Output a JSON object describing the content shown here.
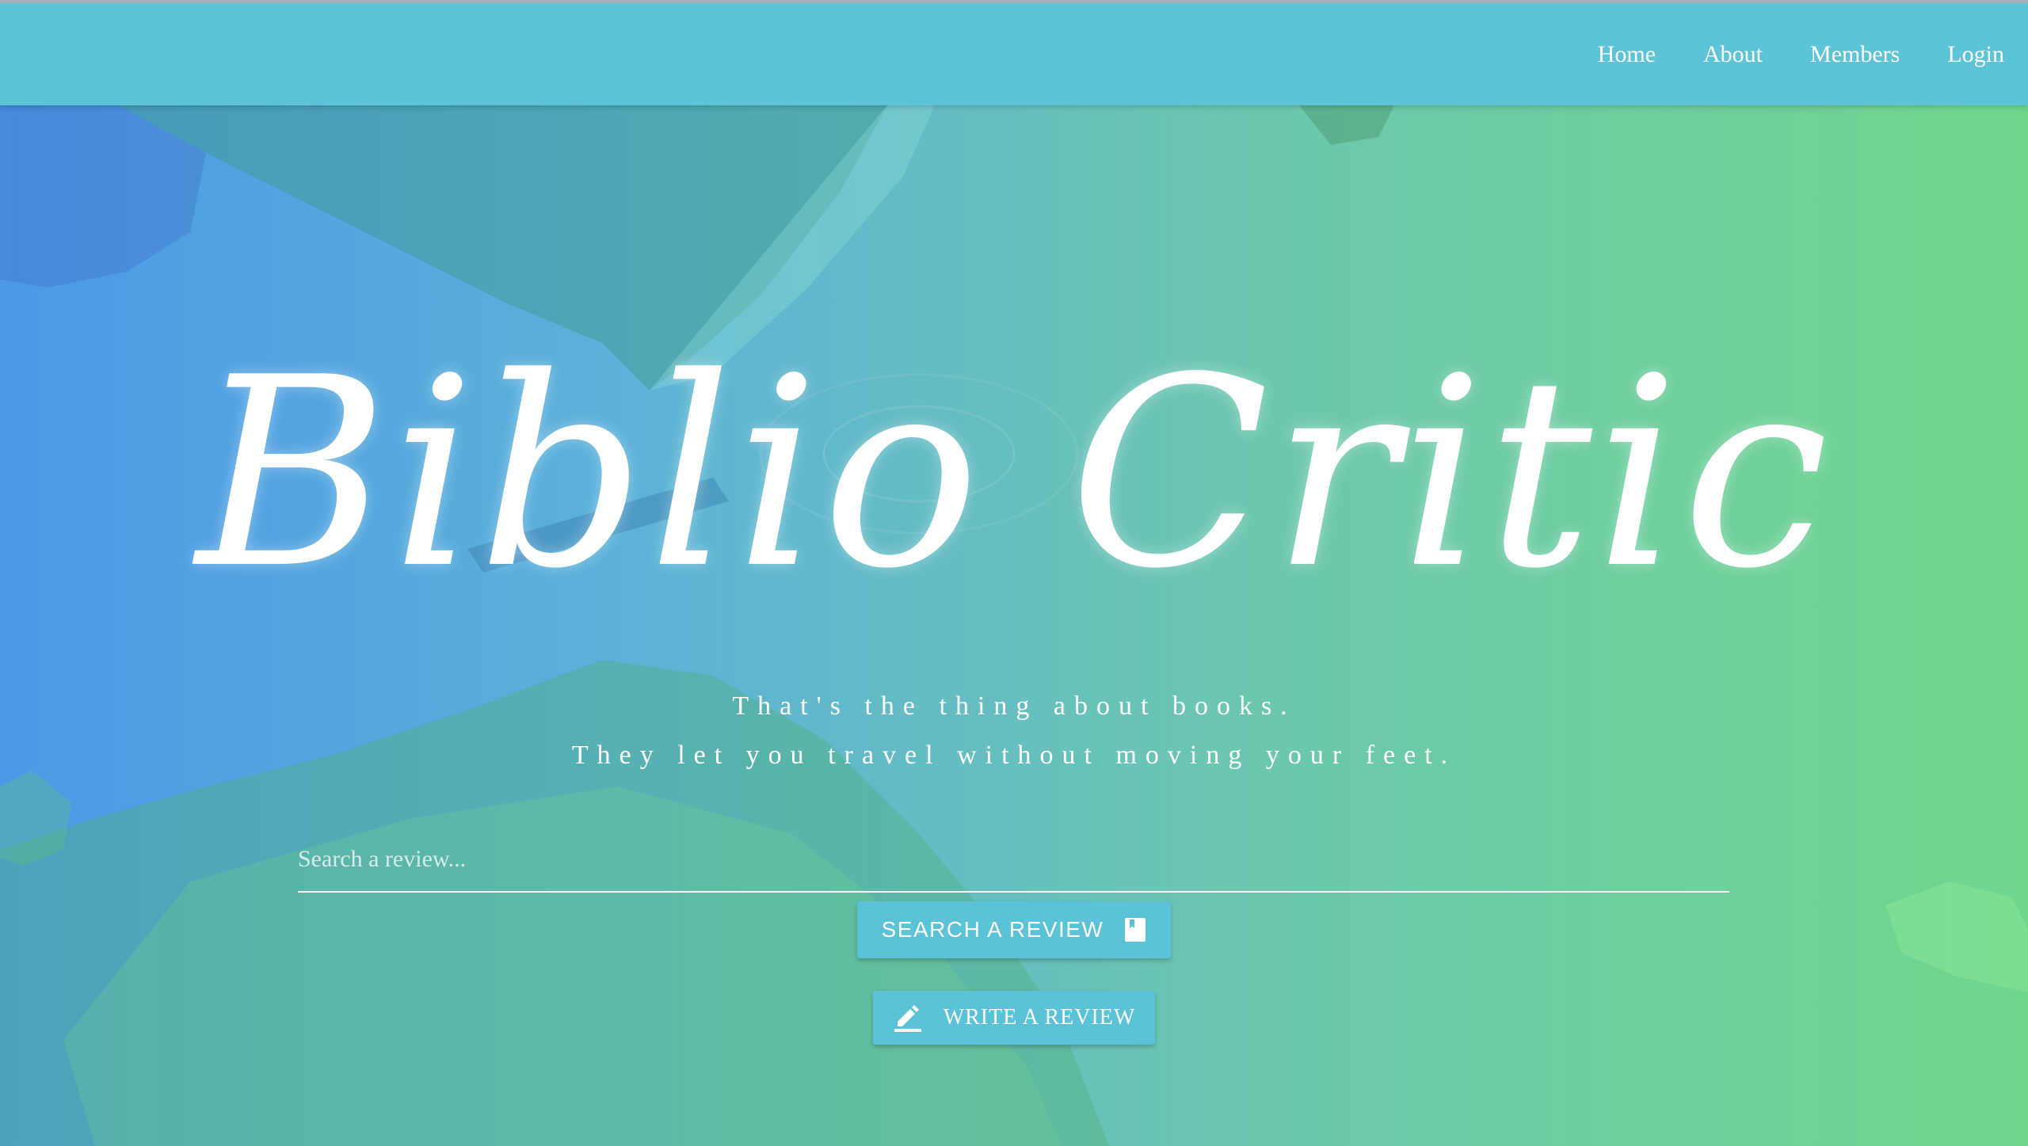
{
  "nav": {
    "links": [
      "Home",
      "About",
      "Members",
      "Login"
    ]
  },
  "hero": {
    "title": "Biblio Critic",
    "tagline_line1": "That's the thing about books.",
    "tagline_line2": "They let you travel without moving your feet."
  },
  "search": {
    "placeholder": "Search a review...",
    "value": ""
  },
  "buttons": {
    "search_label": "SEARCH A REVIEW",
    "search_icon": "book-icon",
    "write_label": "WRITE A REVIEW",
    "write_icon": "pencil-icon"
  },
  "colors": {
    "navbar": "#5dc3d6",
    "button": "#5bc2d8",
    "gradient_left": "#4c98e6",
    "gradient_right": "#70d68c",
    "text": "#ffffff"
  }
}
